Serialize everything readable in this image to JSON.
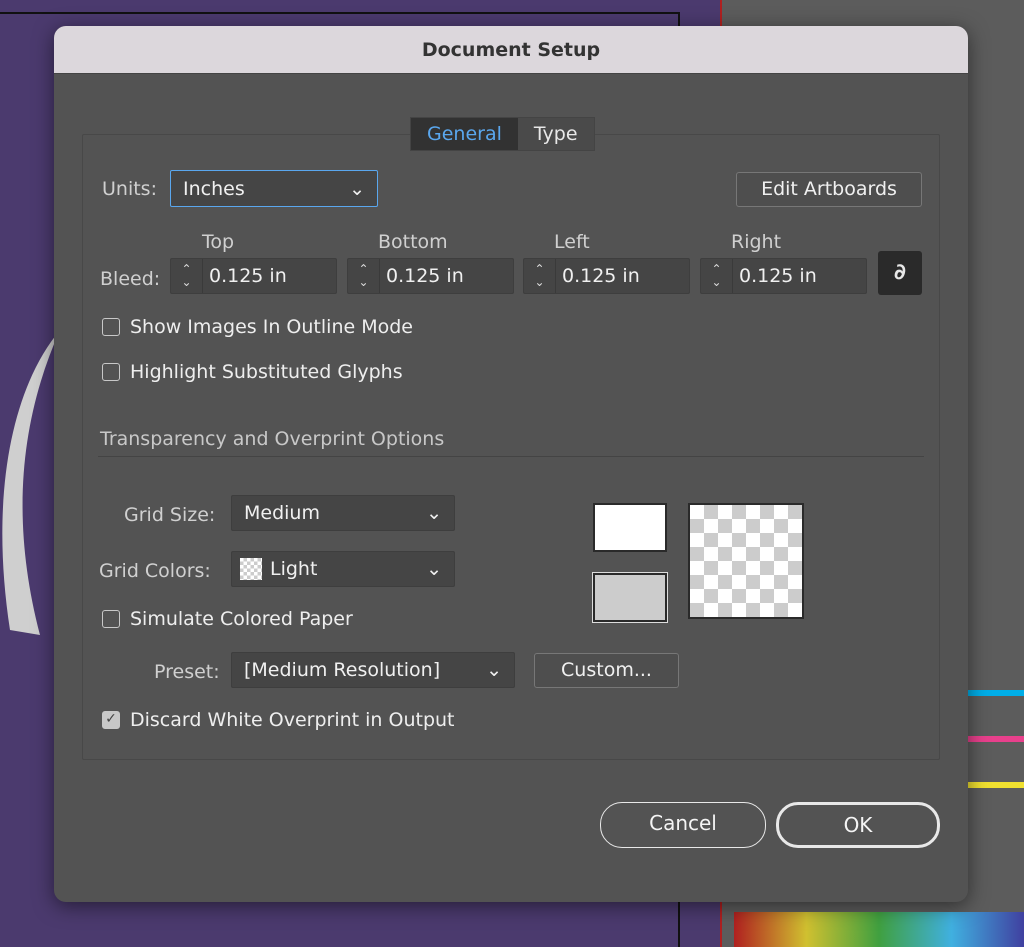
{
  "dialog": {
    "title": "Document Setup"
  },
  "tabs": [
    {
      "label": "General",
      "active": true
    },
    {
      "label": "Type",
      "active": false
    }
  ],
  "units": {
    "label": "Units:",
    "value": "Inches"
  },
  "edit_artboards": "Edit Artboards",
  "bleed": {
    "label": "Bleed:",
    "fields": [
      {
        "label": "Top",
        "value": "0.125 in"
      },
      {
        "label": "Bottom",
        "value": "0.125 in"
      },
      {
        "label": "Left",
        "value": "0.125 in"
      },
      {
        "label": "Right",
        "value": "0.125 in"
      }
    ],
    "linked": true
  },
  "options": {
    "show_images": {
      "label": "Show Images In Outline Mode",
      "checked": false
    },
    "highlight_glyphs": {
      "label": "Highlight Substituted Glyphs",
      "checked": false
    }
  },
  "transparency": {
    "heading": "Transparency and Overprint Options",
    "grid_size": {
      "label": "Grid Size:",
      "value": "Medium"
    },
    "grid_colors": {
      "label": "Grid Colors:",
      "value": "Light"
    },
    "simulate_paper": {
      "label": "Simulate Colored Paper",
      "checked": false
    },
    "preset": {
      "label": "Preset:",
      "value": "[Medium Resolution]"
    },
    "custom": "Custom...",
    "discard_white": {
      "label": "Discard White Overprint in Output",
      "checked": true
    },
    "swatch_top": "#ffffff",
    "swatch_bottom": "#cccccc"
  },
  "buttons": {
    "cancel": "Cancel",
    "ok": "OK"
  },
  "colors": {
    "accent": "#5aa7ee",
    "background": "#4b3a6e",
    "dialog": "#535353"
  }
}
